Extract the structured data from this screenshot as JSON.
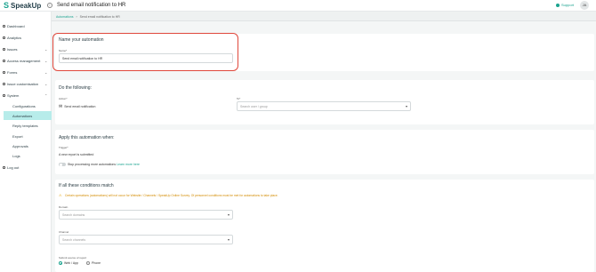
{
  "app": {
    "logo_text": "SpeakUp",
    "page_title": "Send email notification to HR"
  },
  "header": {
    "support_label": "Support",
    "avatar_initials": "JA"
  },
  "sidebar": {
    "items": [
      {
        "label": "Dashboard"
      },
      {
        "label": "Analytics"
      },
      {
        "label": "Issues"
      },
      {
        "label": "Access management"
      },
      {
        "label": "Forms"
      },
      {
        "label": "Issue customisation"
      },
      {
        "label": "System"
      }
    ],
    "sub_items": [
      {
        "label": "Configurations"
      },
      {
        "label": "Automations"
      },
      {
        "label": "Reply templates"
      },
      {
        "label": "Export"
      },
      {
        "label": "Approvals"
      },
      {
        "label": "Logs"
      }
    ],
    "logout_label": "Log out"
  },
  "breadcrumb": {
    "parent": "Automations",
    "current": "Send email notification to HR"
  },
  "name_section": {
    "title": "Name your automation",
    "field_label": "Name*",
    "value": "Send email notification to HR"
  },
  "action_section": {
    "title": "Do the following:",
    "action_label": "Action*",
    "action_value": "Send email notification",
    "to_label": "To*",
    "to_placeholder": "Search user / group"
  },
  "trigger_section": {
    "title": "Apply this automation when:",
    "trigger_label": "Trigger*",
    "trigger_value": "A new report is submitted",
    "stop_label": "Stop processing more automations",
    "learn_more": "Learn more here"
  },
  "conditions_section": {
    "title": "If all these conditions match",
    "warning": "Certain operations (automations) will not occur for Website / Channels / SpeakUp Online Survey. Of personnel conditions must be met for automations to take place.",
    "domain_label": "Domain",
    "domain_placeholder": "Search domains",
    "channel_label": "Channel",
    "channel_placeholder": "Search channels",
    "source_label": "Submit source of report",
    "source_options": [
      "Web / App",
      "Phone"
    ]
  }
}
